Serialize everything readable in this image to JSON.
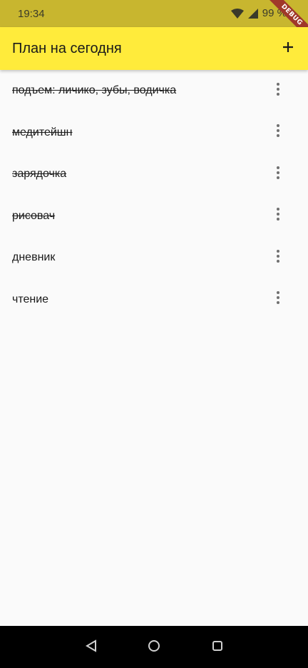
{
  "status_bar": {
    "time": "19:34",
    "battery": "99 %"
  },
  "debug_banner": "DEBUG",
  "app_bar": {
    "title": "План на сегодня",
    "add_icon": "plus-icon"
  },
  "tasks": [
    {
      "label": "подъем: личико, зубы, водичка",
      "done": true
    },
    {
      "label": "медитейшн",
      "done": true
    },
    {
      "label": "зарядочка",
      "done": true
    },
    {
      "label": "рисовач",
      "done": true
    },
    {
      "label": "дневник",
      "done": false
    },
    {
      "label": "чтение",
      "done": false
    }
  ],
  "colors": {
    "app_bar": "#ffeb3b",
    "status_bar": "#c8b62f",
    "background": "#fafafa"
  }
}
